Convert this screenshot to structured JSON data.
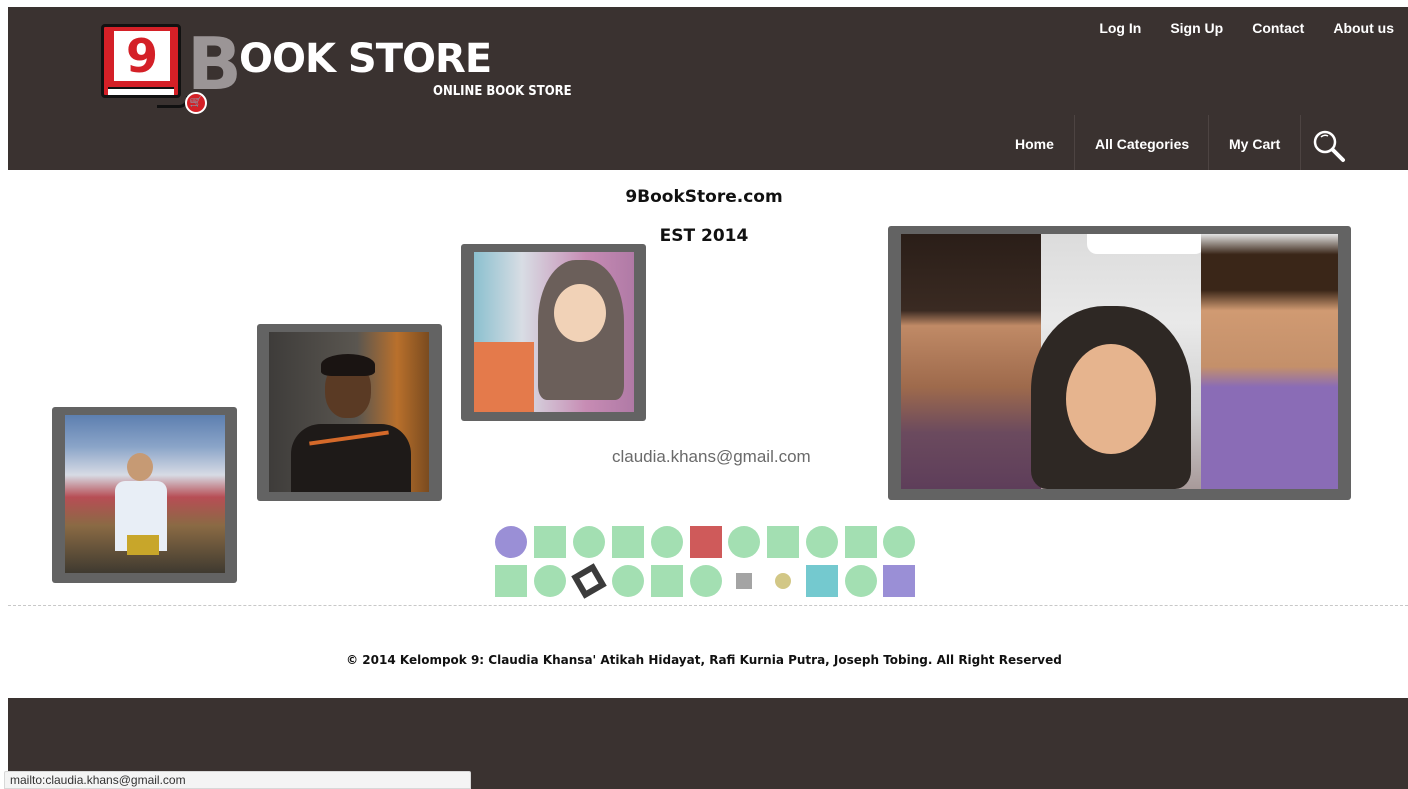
{
  "logo": {
    "number": "9",
    "big_letter": "B",
    "wordmark": "OOK STORE",
    "tagline": "ONLINE BOOK STORE"
  },
  "top_nav": {
    "login": "Log In",
    "signup": "Sign Up",
    "contact": "Contact",
    "about": "About us"
  },
  "main_nav": {
    "home": "Home",
    "categories": "All Categories",
    "cart": "My Cart"
  },
  "content": {
    "site_name": "9BookStore.com",
    "established": "EST 2014",
    "email": "claudia.khans@gmail.com"
  },
  "footer": {
    "copyright": "© 2014 Kelompok 9: Claudia Khansa' Atikah Hidayat, Rafi Kurnia Putra, Joseph Tobing. All Right Reserved"
  },
  "status_bar": {
    "text": "mailto:claudia.khans@gmail.com"
  },
  "colors": {
    "header_bg": "#3a3230",
    "logo_red": "#d42027",
    "shape_green": "#a3dfb2",
    "shape_purple": "#9a8fd6",
    "shape_red": "#cf5a5a",
    "shape_teal": "#74c9cf",
    "shape_gray": "#a4a4a4",
    "shape_olive": "#d2c786",
    "shape_dark": "#3b3b3b"
  }
}
